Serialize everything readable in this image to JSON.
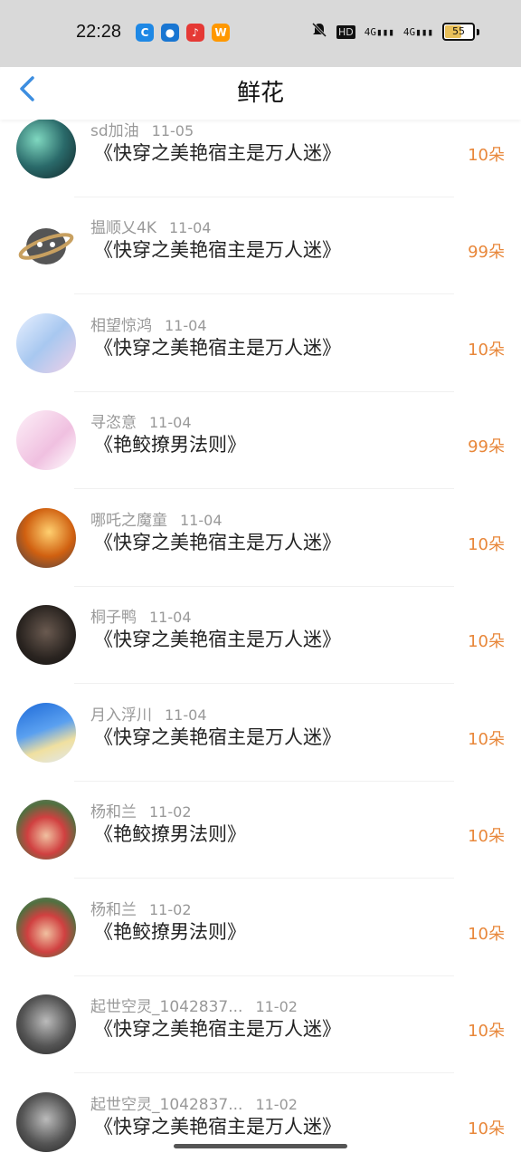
{
  "status_bar": {
    "time": "22:28",
    "hd": "HD",
    "net1": "4G",
    "net2": "4G",
    "battery": "55",
    "app_icons": [
      {
        "name": "app-icon-1",
        "color": "#1e88e5",
        "glyph": "C"
      },
      {
        "name": "app-icon-2",
        "color": "#1976d2",
        "glyph": "●"
      },
      {
        "name": "app-icon-3",
        "color": "#e53935",
        "glyph": "♪"
      },
      {
        "name": "app-icon-4",
        "color": "#ff9800",
        "glyph": "W"
      }
    ]
  },
  "header": {
    "title": "鲜花",
    "back_label": "<"
  },
  "colors": {
    "accent": "#3d8ee0",
    "count": "#e8873a"
  },
  "rows": [
    {
      "user": "sd加油",
      "date": "11-05",
      "book": "《快穿之美艳宿主是万人迷》",
      "count": "10朵"
    },
    {
      "user": "揾顺乂4K",
      "date": "11-04",
      "book": "《快穿之美艳宿主是万人迷》",
      "count": "99朵"
    },
    {
      "user": "相望惊鸿",
      "date": "11-04",
      "book": "《快穿之美艳宿主是万人迷》",
      "count": "10朵"
    },
    {
      "user": "寻恣意",
      "date": "11-04",
      "book": "《艳鲛撩男法则》",
      "count": "99朵"
    },
    {
      "user": "哪吒之魔童",
      "date": "11-04",
      "book": "《快穿之美艳宿主是万人迷》",
      "count": "10朵"
    },
    {
      "user": "桐子鸭",
      "date": "11-04",
      "book": "《快穿之美艳宿主是万人迷》",
      "count": "10朵"
    },
    {
      "user": "月入浮川",
      "date": "11-04",
      "book": "《快穿之美艳宿主是万人迷》",
      "count": "10朵"
    },
    {
      "user": "杨和兰",
      "date": "11-02",
      "book": "《艳鲛撩男法则》",
      "count": "10朵"
    },
    {
      "user": "杨和兰",
      "date": "11-02",
      "book": "《艳鲛撩男法则》",
      "count": "10朵"
    },
    {
      "user": "起世空灵_1042837...",
      "date": "11-02",
      "book": "《快穿之美艳宿主是万人迷》",
      "count": "10朵"
    },
    {
      "user": "起世空灵_1042837...",
      "date": "11-02",
      "book": "《快穿之美艳宿主是万人迷》",
      "count": "10朵"
    }
  ]
}
